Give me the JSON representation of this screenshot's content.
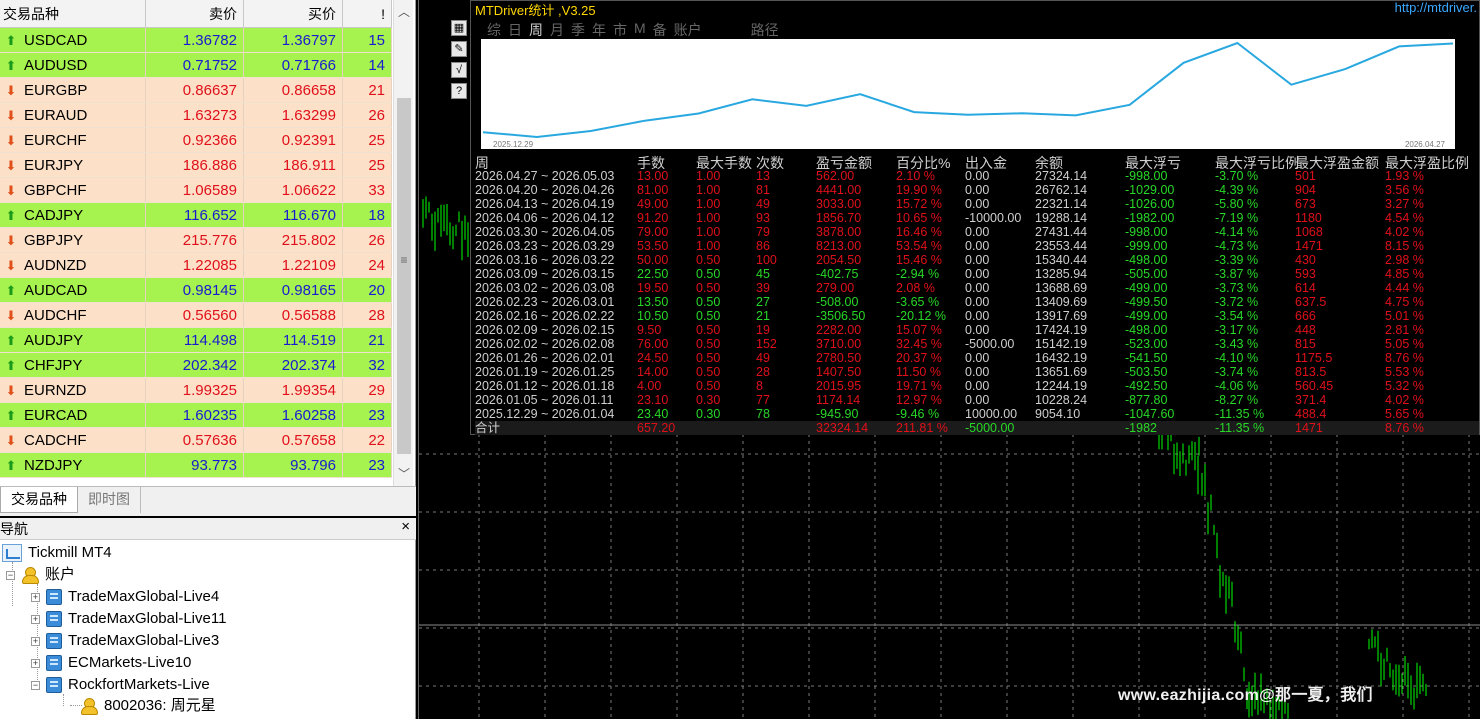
{
  "market_watch": {
    "headers": {
      "symbol": "交易品种",
      "bid": "卖价",
      "ask": "买价",
      "spread": "!"
    },
    "rows": [
      {
        "symbol": "USDCAD",
        "bid": "1.36782",
        "ask": "1.36797",
        "spread": "15",
        "dir": "up",
        "color": "blue"
      },
      {
        "symbol": "AUDUSD",
        "bid": "0.71752",
        "ask": "0.71766",
        "spread": "14",
        "dir": "up",
        "color": "blue"
      },
      {
        "symbol": "EURGBP",
        "bid": "0.86637",
        "ask": "0.86658",
        "spread": "21",
        "dir": "down",
        "color": "red"
      },
      {
        "symbol": "EURAUD",
        "bid": "1.63273",
        "ask": "1.63299",
        "spread": "26",
        "dir": "down",
        "color": "red"
      },
      {
        "symbol": "EURCHF",
        "bid": "0.92366",
        "ask": "0.92391",
        "spread": "25",
        "dir": "down",
        "color": "red"
      },
      {
        "symbol": "EURJPY",
        "bid": "186.886",
        "ask": "186.911",
        "spread": "25",
        "dir": "down",
        "color": "red"
      },
      {
        "symbol": "GBPCHF",
        "bid": "1.06589",
        "ask": "1.06622",
        "spread": "33",
        "dir": "down",
        "color": "red"
      },
      {
        "symbol": "CADJPY",
        "bid": "116.652",
        "ask": "116.670",
        "spread": "18",
        "dir": "up",
        "color": "blue"
      },
      {
        "symbol": "GBPJPY",
        "bid": "215.776",
        "ask": "215.802",
        "spread": "26",
        "dir": "down",
        "color": "red"
      },
      {
        "symbol": "AUDNZD",
        "bid": "1.22085",
        "ask": "1.22109",
        "spread": "24",
        "dir": "down",
        "color": "red"
      },
      {
        "symbol": "AUDCAD",
        "bid": "0.98145",
        "ask": "0.98165",
        "spread": "20",
        "dir": "up",
        "color": "blue"
      },
      {
        "symbol": "AUDCHF",
        "bid": "0.56560",
        "ask": "0.56588",
        "spread": "28",
        "dir": "down",
        "color": "red"
      },
      {
        "symbol": "AUDJPY",
        "bid": "114.498",
        "ask": "114.519",
        "spread": "21",
        "dir": "up",
        "color": "blue"
      },
      {
        "symbol": "CHFJPY",
        "bid": "202.342",
        "ask": "202.374",
        "spread": "32",
        "dir": "up",
        "color": "blue"
      },
      {
        "symbol": "EURNZD",
        "bid": "1.99325",
        "ask": "1.99354",
        "spread": "29",
        "dir": "down",
        "color": "red"
      },
      {
        "symbol": "EURCAD",
        "bid": "1.60235",
        "ask": "1.60258",
        "spread": "23",
        "dir": "up",
        "color": "blue"
      },
      {
        "symbol": "CADCHF",
        "bid": "0.57636",
        "ask": "0.57658",
        "spread": "22",
        "dir": "down",
        "color": "red"
      },
      {
        "symbol": "NZDJPY",
        "bid": "93.773",
        "ask": "93.796",
        "spread": "23",
        "dir": "up",
        "color": "blue"
      }
    ],
    "tabs": [
      "交易品种",
      "即时图"
    ]
  },
  "navigator": {
    "title": "导航",
    "close": "×",
    "platform": "Tickmill MT4",
    "accounts_label": "账户",
    "servers": [
      "TradeMaxGlobal-Live4",
      "TradeMaxGlobal-Live11",
      "TradeMaxGlobal-Live3",
      "ECMarkets-Live10",
      "RockfortMarkets-Live"
    ],
    "account_entry": "8002036: 周元星"
  },
  "stats_panel": {
    "title": "MTDriver统计 ,V3.25",
    "url": "http://mtdriver.",
    "tabs": [
      "综",
      "日",
      "周",
      "月",
      "季",
      "年",
      "市",
      "M",
      "备",
      "账户"
    ],
    "active_tab": "周",
    "extra_tab": "路径",
    "curve_start_label": "2025.12.29",
    "curve_end_label": "2026.04.27",
    "headers": [
      "周",
      "手数",
      "最大手数",
      "次数",
      "盈亏金额",
      "百分比%",
      "出入金",
      "余额",
      "最大浮亏",
      "最大浮亏比例",
      "最大浮盈金额",
      "最大浮盈比例"
    ],
    "rows": [
      {
        "week": "2026.04.27 ~ 2026.05.03",
        "lots": "13.00",
        "maxlots": "1.00",
        "count": "13",
        "pnl": "562.00",
        "pct": "2.10 %",
        "flow": "0.00",
        "balance": "27324.14",
        "maxdd": "-998.00",
        "maxddpct": "-3.70 %",
        "maxfp": "501",
        "maxfppct": "1.93 %",
        "sign": "pos"
      },
      {
        "week": "2026.04.20 ~ 2026.04.26",
        "lots": "81.00",
        "maxlots": "1.00",
        "count": "81",
        "pnl": "4441.00",
        "pct": "19.90 %",
        "flow": "0.00",
        "balance": "26762.14",
        "maxdd": "-1029.00",
        "maxddpct": "-4.39 %",
        "maxfp": "904",
        "maxfppct": "3.56 %",
        "sign": "pos"
      },
      {
        "week": "2026.04.13 ~ 2026.04.19",
        "lots": "49.00",
        "maxlots": "1.00",
        "count": "49",
        "pnl": "3033.00",
        "pct": "15.72 %",
        "flow": "0.00",
        "balance": "22321.14",
        "maxdd": "-1026.00",
        "maxddpct": "-5.80 %",
        "maxfp": "673",
        "maxfppct": "3.27 %",
        "sign": "pos"
      },
      {
        "week": "2026.04.06 ~ 2026.04.12",
        "lots": "91.20",
        "maxlots": "1.00",
        "count": "93",
        "pnl": "1856.70",
        "pct": "10.65 %",
        "flow": "-10000.00",
        "balance": "19288.14",
        "maxdd": "-1982.00",
        "maxddpct": "-7.19 %",
        "maxfp": "1180",
        "maxfppct": "4.54 %",
        "sign": "pos"
      },
      {
        "week": "2026.03.30 ~ 2026.04.05",
        "lots": "79.00",
        "maxlots": "1.00",
        "count": "79",
        "pnl": "3878.00",
        "pct": "16.46 %",
        "flow": "0.00",
        "balance": "27431.44",
        "maxdd": "-998.00",
        "maxddpct": "-4.14 %",
        "maxfp": "1068",
        "maxfppct": "4.02 %",
        "sign": "pos"
      },
      {
        "week": "2026.03.23 ~ 2026.03.29",
        "lots": "53.50",
        "maxlots": "1.00",
        "count": "86",
        "pnl": "8213.00",
        "pct": "53.54 %",
        "flow": "0.00",
        "balance": "23553.44",
        "maxdd": "-999.00",
        "maxddpct": "-4.73 %",
        "maxfp": "1471",
        "maxfppct": "8.15 %",
        "sign": "pos"
      },
      {
        "week": "2026.03.16 ~ 2026.03.22",
        "lots": "50.00",
        "maxlots": "0.50",
        "count": "100",
        "pnl": "2054.50",
        "pct": "15.46 %",
        "flow": "0.00",
        "balance": "15340.44",
        "maxdd": "-498.00",
        "maxddpct": "-3.39 %",
        "maxfp": "430",
        "maxfppct": "2.98 %",
        "sign": "pos"
      },
      {
        "week": "2026.03.09 ~ 2026.03.15",
        "lots": "22.50",
        "maxlots": "0.50",
        "count": "45",
        "pnl": "-402.75",
        "pct": "-2.94 %",
        "flow": "0.00",
        "balance": "13285.94",
        "maxdd": "-505.00",
        "maxddpct": "-3.87 %",
        "maxfp": "593",
        "maxfppct": "4.85 %",
        "sign": "neg"
      },
      {
        "week": "2026.03.02 ~ 2026.03.08",
        "lots": "19.50",
        "maxlots": "0.50",
        "count": "39",
        "pnl": "279.00",
        "pct": "2.08 %",
        "flow": "0.00",
        "balance": "13688.69",
        "maxdd": "-499.00",
        "maxddpct": "-3.73 %",
        "maxfp": "614",
        "maxfppct": "4.44 %",
        "sign": "pos"
      },
      {
        "week": "2026.02.23 ~ 2026.03.01",
        "lots": "13.50",
        "maxlots": "0.50",
        "count": "27",
        "pnl": "-508.00",
        "pct": "-3.65 %",
        "flow": "0.00",
        "balance": "13409.69",
        "maxdd": "-499.50",
        "maxddpct": "-3.72 %",
        "maxfp": "637.5",
        "maxfppct": "4.75 %",
        "sign": "neg"
      },
      {
        "week": "2026.02.16 ~ 2026.02.22",
        "lots": "10.50",
        "maxlots": "0.50",
        "count": "21",
        "pnl": "-3506.50",
        "pct": "-20.12 %",
        "flow": "0.00",
        "balance": "13917.69",
        "maxdd": "-499.00",
        "maxddpct": "-3.54 %",
        "maxfp": "666",
        "maxfppct": "5.01 %",
        "sign": "neg"
      },
      {
        "week": "2026.02.09 ~ 2026.02.15",
        "lots": "9.50",
        "maxlots": "0.50",
        "count": "19",
        "pnl": "2282.00",
        "pct": "15.07 %",
        "flow": "0.00",
        "balance": "17424.19",
        "maxdd": "-498.00",
        "maxddpct": "-3.17 %",
        "maxfp": "448",
        "maxfppct": "2.81 %",
        "sign": "pos"
      },
      {
        "week": "2026.02.02 ~ 2026.02.08",
        "lots": "76.00",
        "maxlots": "0.50",
        "count": "152",
        "pnl": "3710.00",
        "pct": "32.45 %",
        "flow": "-5000.00",
        "balance": "15142.19",
        "maxdd": "-523.00",
        "maxddpct": "-3.43 %",
        "maxfp": "815",
        "maxfppct": "5.05 %",
        "sign": "pos"
      },
      {
        "week": "2026.01.26 ~ 2026.02.01",
        "lots": "24.50",
        "maxlots": "0.50",
        "count": "49",
        "pnl": "2780.50",
        "pct": "20.37 %",
        "flow": "0.00",
        "balance": "16432.19",
        "maxdd": "-541.50",
        "maxddpct": "-4.10 %",
        "maxfp": "1175.5",
        "maxfppct": "8.76 %",
        "sign": "pos"
      },
      {
        "week": "2026.01.19 ~ 2026.01.25",
        "lots": "14.00",
        "maxlots": "0.50",
        "count": "28",
        "pnl": "1407.50",
        "pct": "11.50 %",
        "flow": "0.00",
        "balance": "13651.69",
        "maxdd": "-503.50",
        "maxddpct": "-3.74 %",
        "maxfp": "813.5",
        "maxfppct": "5.53 %",
        "sign": "pos"
      },
      {
        "week": "2026.01.12 ~ 2026.01.18",
        "lots": "4.00",
        "maxlots": "0.50",
        "count": "8",
        "pnl": "2015.95",
        "pct": "19.71 %",
        "flow": "0.00",
        "balance": "12244.19",
        "maxdd": "-492.50",
        "maxddpct": "-4.06 %",
        "maxfp": "560.45",
        "maxfppct": "5.32 %",
        "sign": "pos"
      },
      {
        "week": "2026.01.05 ~ 2026.01.11",
        "lots": "23.10",
        "maxlots": "0.30",
        "count": "77",
        "pnl": "1174.14",
        "pct": "12.97 %",
        "flow": "0.00",
        "balance": "10228.24",
        "maxdd": "-877.80",
        "maxddpct": "-8.27 %",
        "maxfp": "371.4",
        "maxfppct": "4.02 %",
        "sign": "pos"
      },
      {
        "week": "2025.12.29 ~ 2026.01.04",
        "lots": "23.40",
        "maxlots": "0.30",
        "count": "78",
        "pnl": "-945.90",
        "pct": "-9.46 %",
        "flow": "10000.00",
        "balance": "9054.10",
        "maxdd": "-1047.60",
        "maxddpct": "-11.35 %",
        "maxfp": "488.4",
        "maxfppct": "5.65 %",
        "sign": "neg"
      }
    ],
    "total": {
      "label": "合计",
      "lots": "657.20",
      "pnl": "32324.14",
      "pct": "211.81 %",
      "flow": "-5000.00",
      "maxdd": "-1982",
      "maxddpct": "-11.35 %",
      "maxfp": "1471",
      "maxfppct": "8.76 %"
    }
  },
  "toolbox_icons": [
    "chart-icon",
    "draw-icon",
    "check-icon",
    "help-icon"
  ],
  "toolbox_glyphs": [
    "▦",
    "✎",
    "√",
    "?"
  ],
  "watermark": "www.eazhijia.com@那一夏，我们",
  "colors": {
    "up_row": "#a6f24e",
    "down_row": "#fde0c8",
    "bid_blue": "#1a1ad0",
    "bid_red": "#e0101a",
    "profit_red": "#e0101a",
    "loss_green": "#28d828",
    "title_yellow": "#ffd800",
    "url_blue": "#3aa8ff",
    "candle_green": "#00ff00",
    "equity_curve": "#29a8e0"
  }
}
